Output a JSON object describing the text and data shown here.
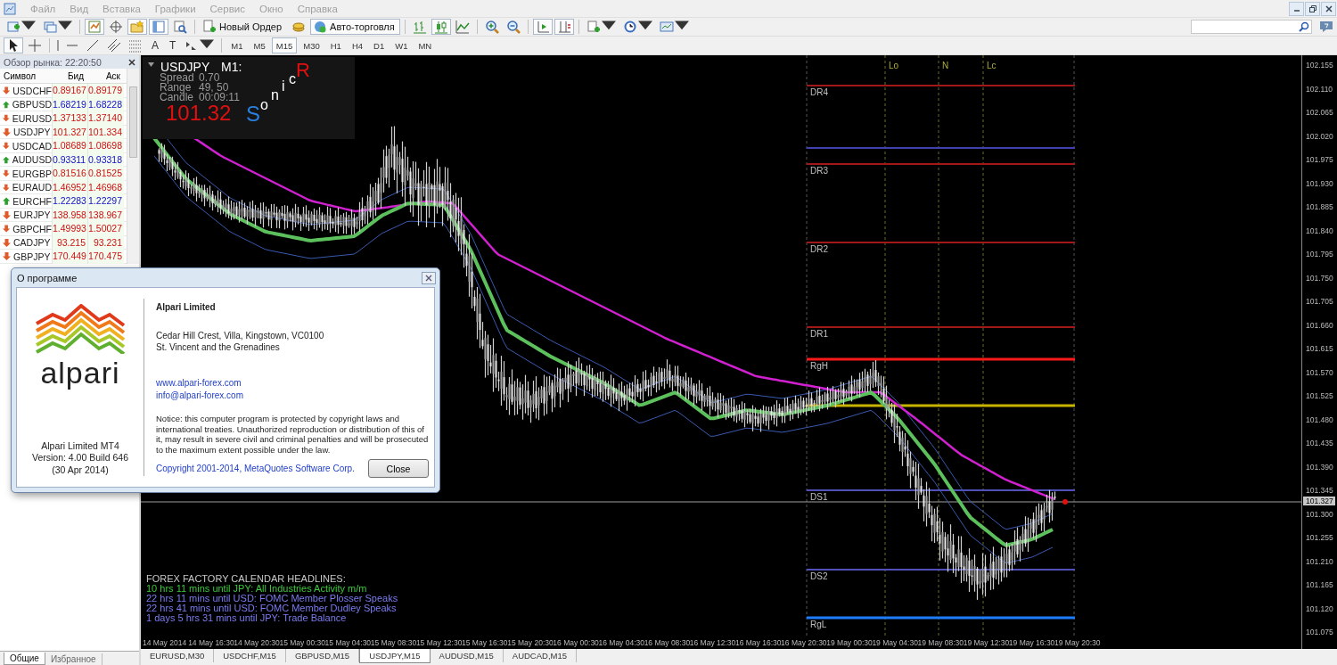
{
  "menu": [
    "Файл",
    "Вид",
    "Вставка",
    "Графики",
    "Сервис",
    "Окно",
    "Справка"
  ],
  "toolbar_main": [
    {
      "kind": "menu_icon",
      "pressed": false
    },
    {
      "kind": "menu_icon",
      "pressed": false
    },
    {
      "kind": "separator"
    },
    {
      "kind": "icon",
      "pressed": true
    },
    {
      "kind": "icon",
      "pressed": false
    },
    {
      "kind": "icon",
      "pressed": true
    },
    {
      "kind": "icon",
      "pressed": true
    },
    {
      "kind": "icon",
      "pressed": false
    },
    {
      "kind": "separator"
    },
    {
      "kind": "button",
      "label": "Новый Ордер",
      "pressed": false
    },
    {
      "kind": "icon",
      "pressed": false
    },
    {
      "kind": "button",
      "label": "Авто-торговля",
      "pressed": true
    },
    {
      "kind": "separator"
    },
    {
      "kind": "icon",
      "pressed": false
    },
    {
      "kind": "icon",
      "pressed": true
    },
    {
      "kind": "icon",
      "pressed": false
    },
    {
      "kind": "separator"
    },
    {
      "kind": "icon",
      "pressed": false
    },
    {
      "kind": "icon",
      "pressed": false
    },
    {
      "kind": "separator"
    },
    {
      "kind": "icon",
      "pressed": true
    },
    {
      "kind": "icon",
      "pressed": true
    },
    {
      "kind": "separator"
    },
    {
      "kind": "menu_icon",
      "pressed": false
    },
    {
      "kind": "menu_icon",
      "pressed": false
    },
    {
      "kind": "menu_icon",
      "pressed": false
    }
  ],
  "toolbar_drawing": [
    {
      "kind": "icon",
      "pressed": true
    },
    {
      "kind": "icon",
      "pressed": false
    },
    {
      "kind": "separator"
    },
    {
      "kind": "icon",
      "pressed": false
    },
    {
      "kind": "icon",
      "pressed": false
    },
    {
      "kind": "icon",
      "pressed": false
    },
    {
      "kind": "icon",
      "pressed": false
    },
    {
      "kind": "icon",
      "pressed": false
    },
    {
      "kind": "glyph",
      "label": "A",
      "pressed": false
    },
    {
      "kind": "glyph",
      "label": "T",
      "pressed": false
    },
    {
      "kind": "menu_icon",
      "pressed": false
    },
    {
      "kind": "separator"
    },
    {
      "kind": "timeframe",
      "label": "M1",
      "selected": false
    },
    {
      "kind": "timeframe",
      "label": "M5",
      "selected": false
    },
    {
      "kind": "timeframe",
      "label": "M15",
      "selected": true
    },
    {
      "kind": "timeframe",
      "label": "M30",
      "selected": false
    },
    {
      "kind": "timeframe",
      "label": "H1",
      "selected": false
    },
    {
      "kind": "timeframe",
      "label": "H4",
      "selected": false
    },
    {
      "kind": "timeframe",
      "label": "D1",
      "selected": false
    },
    {
      "kind": "timeframe",
      "label": "W1",
      "selected": false
    },
    {
      "kind": "timeframe",
      "label": "MN",
      "selected": false
    }
  ],
  "market_watch": {
    "title": "Обзор рынка: 22:20:50",
    "columns": [
      "Символ",
      "Бид",
      "Аск"
    ],
    "rows": [
      {
        "symbol": "USDCHF",
        "bid": "0.89167",
        "ask": "0.89179",
        "rising": false
      },
      {
        "symbol": "GBPUSD",
        "bid": "1.68219",
        "ask": "1.68228",
        "rising": true
      },
      {
        "symbol": "EURUSD",
        "bid": "1.37133",
        "ask": "1.37140",
        "rising": false
      },
      {
        "symbol": "USDJPY",
        "bid": "101.327",
        "ask": "101.334",
        "rising": false
      },
      {
        "symbol": "USDCAD",
        "bid": "1.08689",
        "ask": "1.08698",
        "rising": false
      },
      {
        "symbol": "AUDUSD",
        "bid": "0.93311",
        "ask": "0.93318",
        "rising": true
      },
      {
        "symbol": "EURGBP",
        "bid": "0.81516",
        "ask": "0.81525",
        "rising": false
      },
      {
        "symbol": "EURAUD",
        "bid": "1.46952",
        "ask": "1.46968",
        "rising": false
      },
      {
        "symbol": "EURCHF",
        "bid": "1.22283",
        "ask": "1.22297",
        "rising": true
      },
      {
        "symbol": "EURJPY",
        "bid": "138.958",
        "ask": "138.967",
        "rising": false
      },
      {
        "symbol": "GBPCHF",
        "bid": "1.49993",
        "ask": "1.50027",
        "rising": false
      },
      {
        "symbol": "CADJPY",
        "bid": "93.215",
        "ask": "93.231",
        "rising": false
      },
      {
        "symbol": "GBPJPY",
        "bid": "170.449",
        "ask": "170.475",
        "rising": false
      }
    ]
  },
  "panel_tabs": [
    {
      "label": "Общие",
      "selected": true
    },
    {
      "label": "Избранное",
      "selected": false
    }
  ],
  "chart": {
    "info": {
      "symbol": "USDJPY",
      "timeframe": "M1:",
      "rows": [
        {
          "label": "Spread",
          "value": "0.70"
        },
        {
          "label": "Range",
          "value": "49, 50"
        },
        {
          "label": "Candle",
          "value": "00:09:11"
        }
      ],
      "price": "101.32"
    },
    "logo": "SonicR",
    "sessions": [
      "Lo",
      "N",
      "Lc"
    ],
    "levels": [
      {
        "label": "DR4",
        "color": "#a01818",
        "thick": false
      },
      {
        "color": "#4040b0",
        "thick": false
      },
      {
        "label": "DR3",
        "color": "#a01818",
        "thick": false
      },
      {
        "label": "DR2",
        "color": "#a01818",
        "thick": false
      },
      {
        "label": "DR1",
        "color": "#a01818",
        "thick": false
      },
      {
        "label": "RgH",
        "color": "#ff1a1a",
        "thick": true
      },
      {
        "color": "#c8b400",
        "thick": true
      },
      {
        "label": "DS1",
        "color": "#5050b8",
        "thick": false
      },
      {
        "label": "DS2",
        "color": "#5050b8",
        "thick": false
      },
      {
        "label": "RgL",
        "color": "#1e7cff",
        "thick": true
      }
    ],
    "headlines": {
      "title": "FOREX FACTORY CALENDAR HEADLINES:",
      "items": [
        {
          "text": "10 hrs 11 mins until JPY: All Industries Activity m/m",
          "color": "#3cc83c"
        },
        {
          "text": "22 hrs 11 mins until USD: FOMC Member Plosser Speaks",
          "color": "#7b7bf0"
        },
        {
          "text": "22 hrs 41 mins until USD: FOMC Member Dudley Speaks",
          "color": "#7b7bf0"
        },
        {
          "text": "1 days 5 hrs 31 mins until JPY: Trade Balance",
          "color": "#7b7bf0"
        }
      ]
    },
    "price_axis": [
      "102.155",
      "102.110",
      "102.065",
      "102.020",
      "101.975",
      "101.930",
      "101.885",
      "101.840",
      "101.795",
      "101.750",
      "101.705",
      "101.660",
      "101.615",
      "101.570",
      "101.525",
      "101.480",
      "101.435",
      "101.390",
      "101.345",
      "101.300",
      "101.255",
      "101.210",
      "101.165",
      "101.120",
      "101.075"
    ],
    "current_price": "101.327",
    "time_axis": [
      "14 May 2014",
      "14 May 16:30",
      "14 May 20:30",
      "15 May 00:30",
      "15 May 04:30",
      "15 May 08:30",
      "15 May 12:30",
      "15 May 16:30",
      "15 May 20:30",
      "16 May 00:30",
      "16 May 04:30",
      "16 May 08:30",
      "16 May 12:30",
      "16 May 16:30",
      "16 May 20:30",
      "19 May 00:30",
      "19 May 04:30",
      "19 May 08:30",
      "19 May 12:30",
      "19 May 16:30",
      "19 May 20:30"
    ]
  },
  "chart_tabs": [
    {
      "label": "EURUSD,M30",
      "selected": false
    },
    {
      "label": "USDCHF,M15",
      "selected": false
    },
    {
      "label": "GBPUSD,M15",
      "selected": false
    },
    {
      "label": "USDJPY,M15",
      "selected": true
    },
    {
      "label": "AUDUSD,M15",
      "selected": false
    },
    {
      "label": "AUDCAD,M15",
      "selected": false
    }
  ],
  "dialog": {
    "title": "О программе",
    "logo_text": "alpari",
    "caption": [
      "Alpari Limited MT4",
      "Version: 4.00  Build 646",
      "(30 Apr 2014)"
    ],
    "company": "Alpari Limited",
    "address": [
      "Cedar Hill Crest, Villa, Kingstown, VC0100",
      "St. Vincent and the Grenadines"
    ],
    "links": [
      "www.alpari-forex.com",
      "info@alpari-forex.com"
    ],
    "notice": "Notice: this computer program is protected by copyright laws and international treaties. Unauthorized reproduction or distribution of this of it, may result in severe civil and criminal penalties and will be prosecuted to the maximum extent possible under the law.",
    "copyright": "Copyright 2001-2014, MetaQuotes Software Corp.",
    "button": "Close"
  }
}
